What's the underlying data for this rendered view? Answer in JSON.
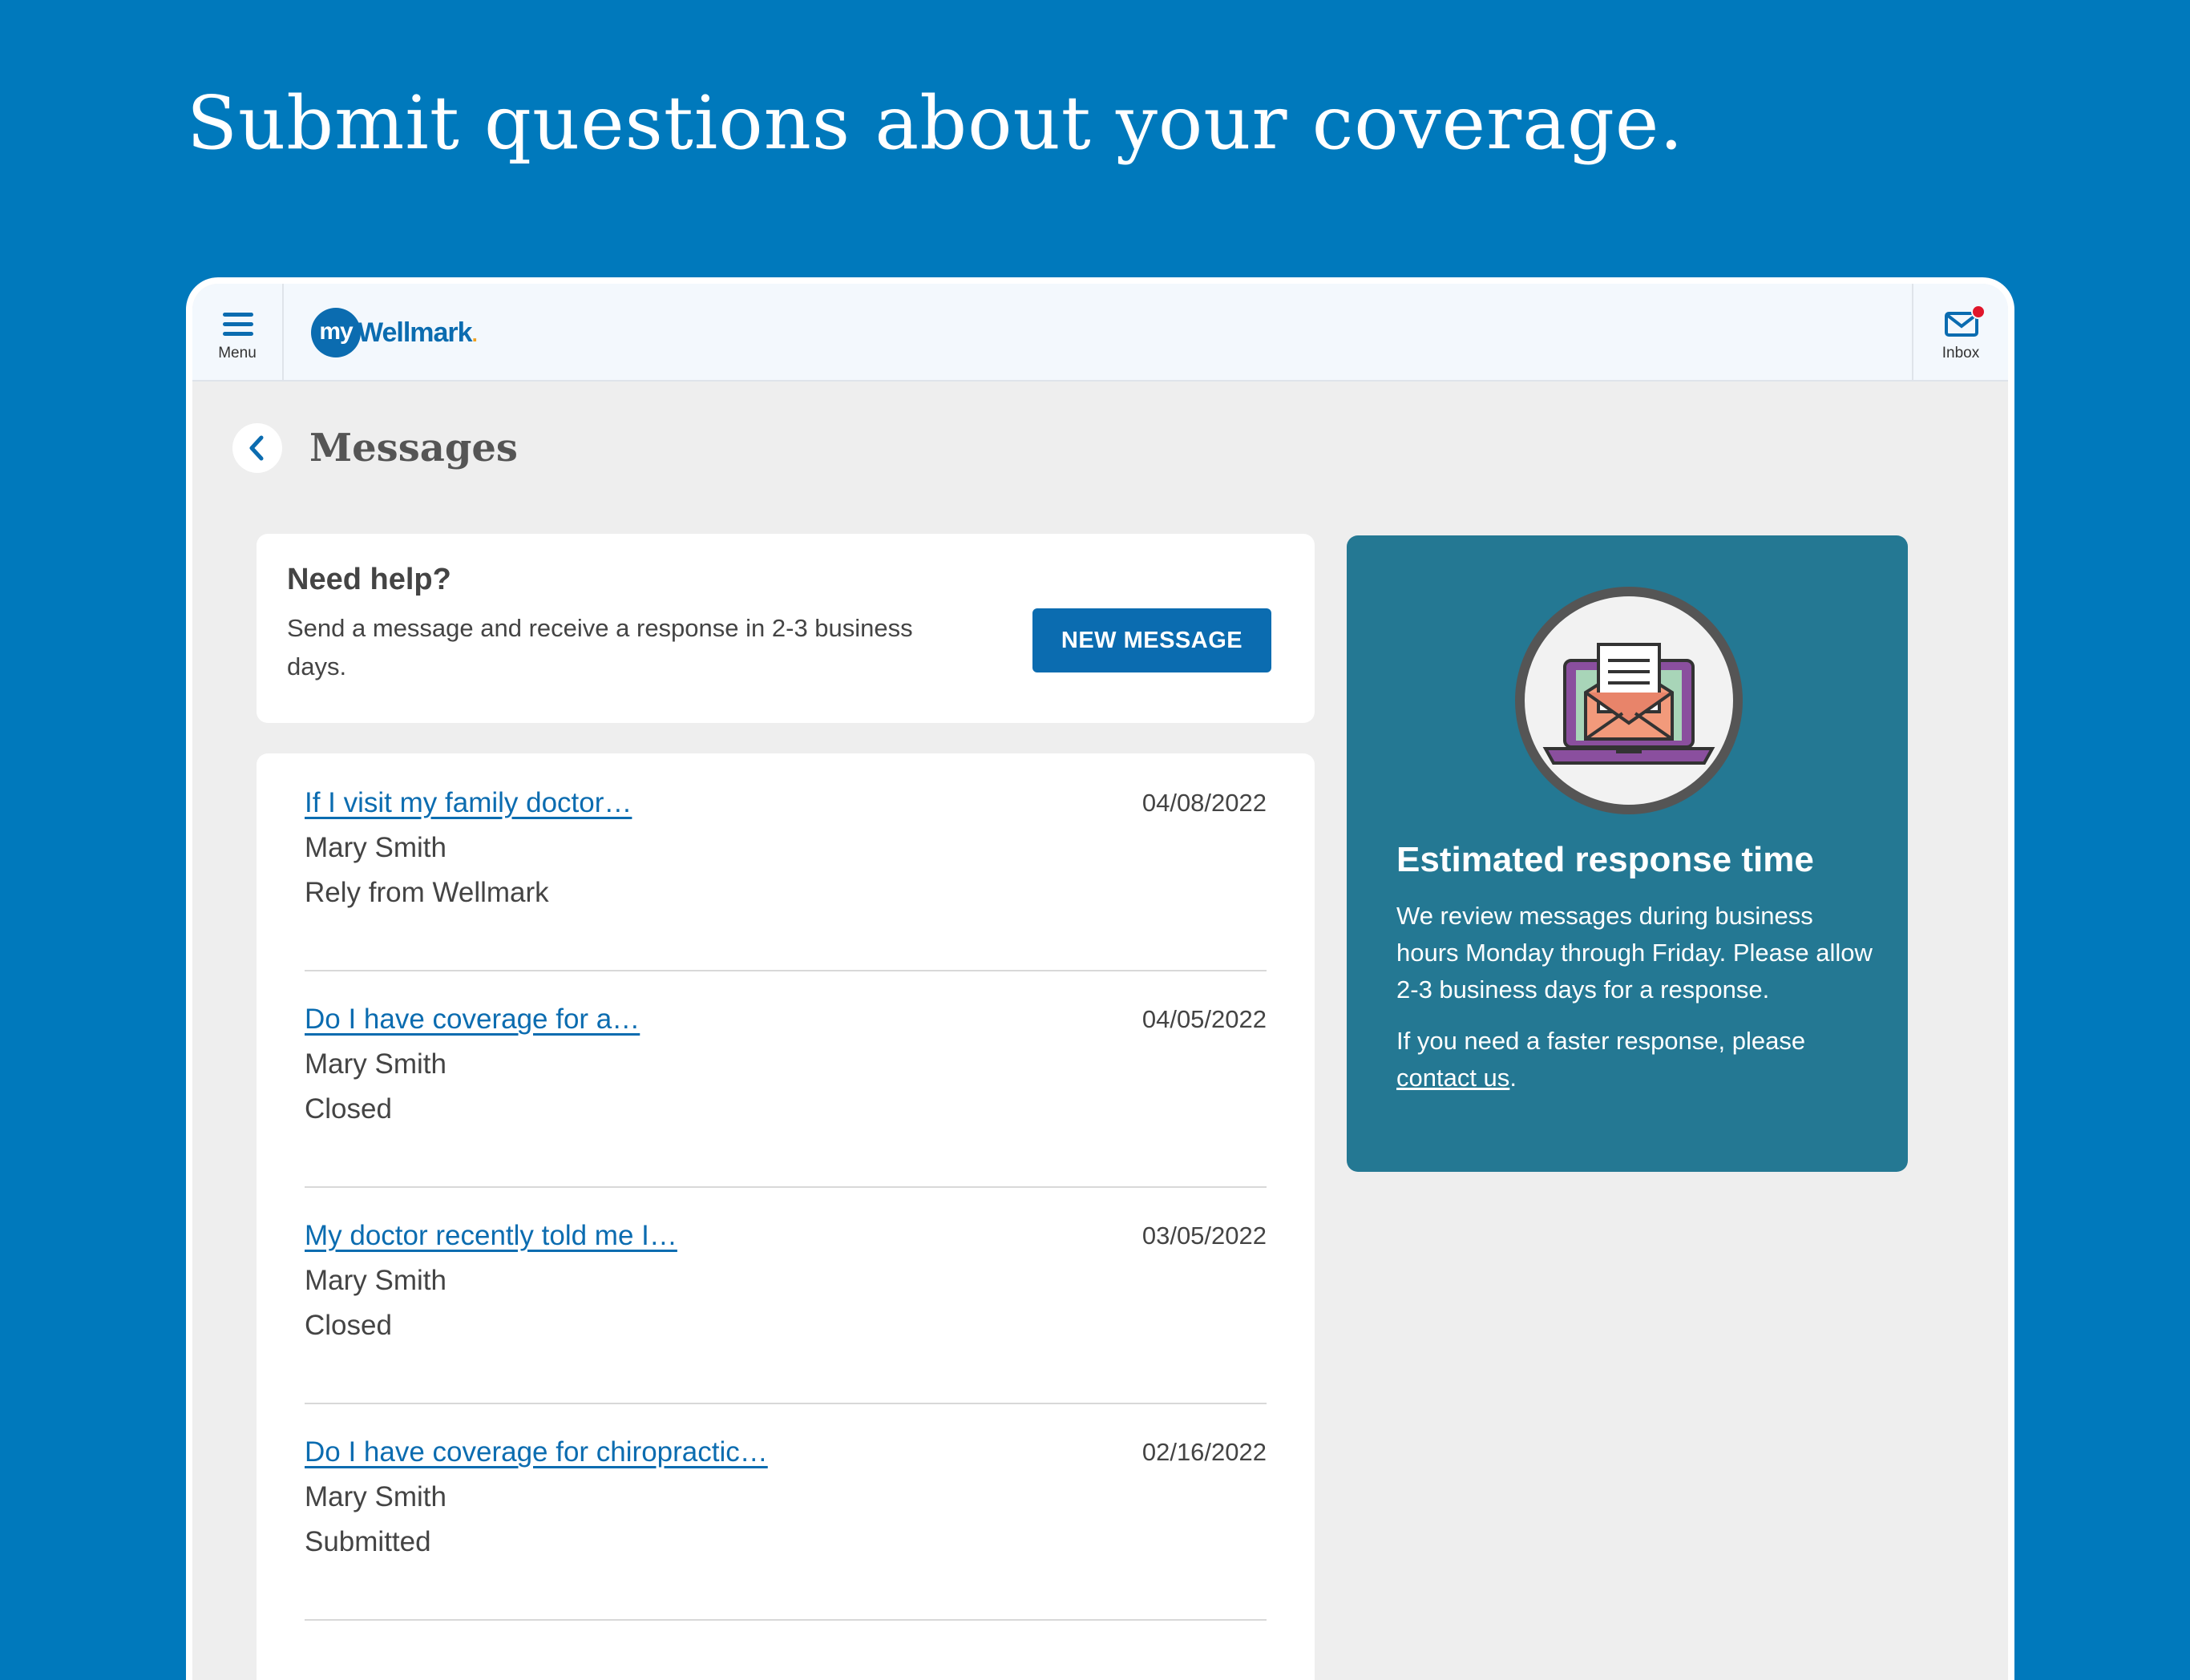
{
  "headline": "Submit questions about your coverage.",
  "topbar": {
    "menu_label": "Menu",
    "logo_prefix": "my",
    "logo_word": "Wellmark",
    "inbox_label": "Inbox"
  },
  "page": {
    "title": "Messages"
  },
  "help_card": {
    "title": "Need help?",
    "text": "Send a message and receive a response in 2-3 business days.",
    "button_label": "NEW MESSAGE"
  },
  "messages": [
    {
      "subject": "If I visit my family doctor…",
      "date": "04/08/2022",
      "sender": "Mary Smith",
      "status": "Rely from Wellmark"
    },
    {
      "subject": "Do I have coverage for a…",
      "date": "04/05/2022",
      "sender": "Mary Smith",
      "status": "Closed"
    },
    {
      "subject": "My doctor recently told me I…",
      "date": "03/05/2022",
      "sender": "Mary Smith",
      "status": "Closed"
    },
    {
      "subject": "Do I have coverage for chiropractic…",
      "date": "02/16/2022",
      "sender": "Mary Smith",
      "status": "Submitted"
    }
  ],
  "info_card": {
    "title": "Estimated response time",
    "paragraph1": "We review messages during business hours Monday through Friday. Please allow 2-3 business days for a response.",
    "paragraph2_prefix": "If you need a faster response, please ",
    "paragraph2_link": "contact us",
    "paragraph2_suffix": "."
  },
  "colors": {
    "background": "#0079bc",
    "brand_blue": "#0b6cb0",
    "info_card": "#247893",
    "notification_dot": "#e0162b"
  },
  "icons": [
    "hamburger-icon",
    "envelope-icon",
    "chevron-left-icon",
    "laptop-envelope-illustration"
  ]
}
